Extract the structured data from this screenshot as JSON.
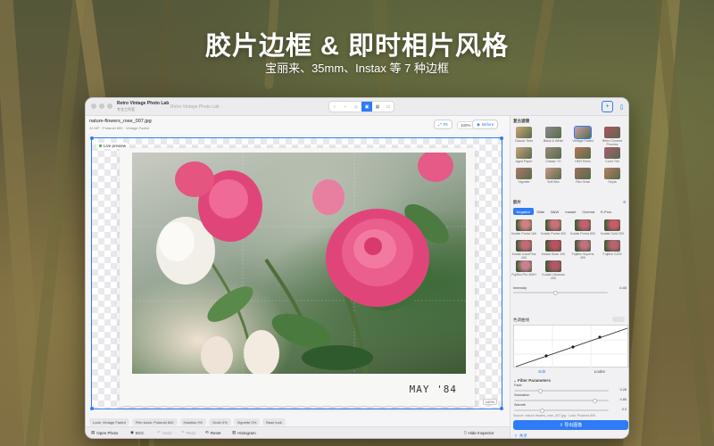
{
  "headline": "胶片边框 & 即时相片风格",
  "subheadline": "宝丽来、35mm、Instax 等 7 种边框",
  "window": {
    "app_title": "Retro Vintage Photo Lab",
    "app_subtitle": "专业工作室",
    "window_title": "Retro Vintage Photo Lab"
  },
  "file": {
    "name": "nature-flowers_rose_007.jpg",
    "meta": "24 MP · Polaroid 600 · Vintage Faded"
  },
  "toolbar": {
    "fit_label": "Fit",
    "zoom_value": "100%",
    "before_label": "Before"
  },
  "canvas": {
    "live_preview": "Live preview",
    "caption": "MAY '84",
    "zoom_pct": "100%"
  },
  "chips": [
    "Look: Vintage Faded",
    "Film stock: Polaroid 600",
    "Halation 0%",
    "Grain 0%",
    "Vignette 0%",
    "Base look"
  ],
  "bottombar": {
    "open_photo": "Open Photo",
    "compare": "ECC",
    "undo": "Undo",
    "redo": "Redo",
    "reset": "Reset",
    "histogram": "Histogram",
    "hide_inspector": "Hide Inspector"
  },
  "inspector": {
    "presets_title": "复古滤镜",
    "presets": [
      {
        "label": "Classic Tone",
        "color": "#c8a878"
      },
      {
        "label": "Black & White",
        "color": "#8a8a8a"
      },
      {
        "label": "Vintage Faded",
        "color": "#c9a0a8"
      },
      {
        "label": "Retro Chrome Process",
        "color": "#b05060"
      },
      {
        "label": "Aged Paper",
        "color": "#c2a47e"
      },
      {
        "label": "Classic TV",
        "color": "#9a8a7a"
      },
      {
        "label": "HDR Retro",
        "color": "#b07858"
      },
      {
        "label": "Color Tint",
        "color": "#a86070"
      },
      {
        "label": "Vignette",
        "color": "#aa7a6a"
      },
      {
        "label": "Soft Blur",
        "color": "#c49a88"
      },
      {
        "label": "Film Grain",
        "color": "#9a7060"
      },
      {
        "label": "Sepia",
        "color": "#b08060"
      }
    ],
    "film_title": "胶片",
    "film_tabs": [
      "Negative",
      "Slide",
      "B&W",
      "Instant",
      "Cinema",
      "E-Proc"
    ],
    "films": [
      {
        "label": "Kodak Portra 160",
        "color": "#d08080"
      },
      {
        "label": "Kodak Portra 400",
        "color": "#c87078"
      },
      {
        "label": "Kodak Portra 800",
        "color": "#c06070"
      },
      {
        "label": "Kodak Gold 200",
        "color": "#c85a6a"
      },
      {
        "label": "Kodak ColorPlus 200",
        "color": "#c26a78"
      },
      {
        "label": "Kodak Ektar 100",
        "color": "#b85060"
      },
      {
        "label": "Fujifilm Superia 400",
        "color": "#c07080"
      },
      {
        "label": "Fujifilm C200",
        "color": "#b86272"
      },
      {
        "label": "Fujifilm Pro 400H",
        "color": "#c88090"
      },
      {
        "label": "Kodak Ultramax 400",
        "color": "#b05868"
      }
    ],
    "intensity_label": "Intensity",
    "intensity_value": "0.45",
    "intensity": 0.45,
    "curve_title": "色调曲线",
    "edit_tabs": [
      "Edit",
      "Looks"
    ],
    "params_title": "Filter Parameters",
    "params": [
      {
        "label": "Fade",
        "value": "0.28",
        "level": 0.28
      },
      {
        "label": "Saturation",
        "value": "0.85",
        "level": 0.85
      },
      {
        "label": "Warmth",
        "value": "0.3",
        "level": 0.3
      }
    ],
    "source_text": "Source: nature-flowers_rose_007.jpg · Look: Polaroid 600",
    "export_label": "导出图像",
    "share_label": "共享"
  },
  "colors": {
    "accent": "#2f7bf5",
    "rose": "#e0457a"
  }
}
